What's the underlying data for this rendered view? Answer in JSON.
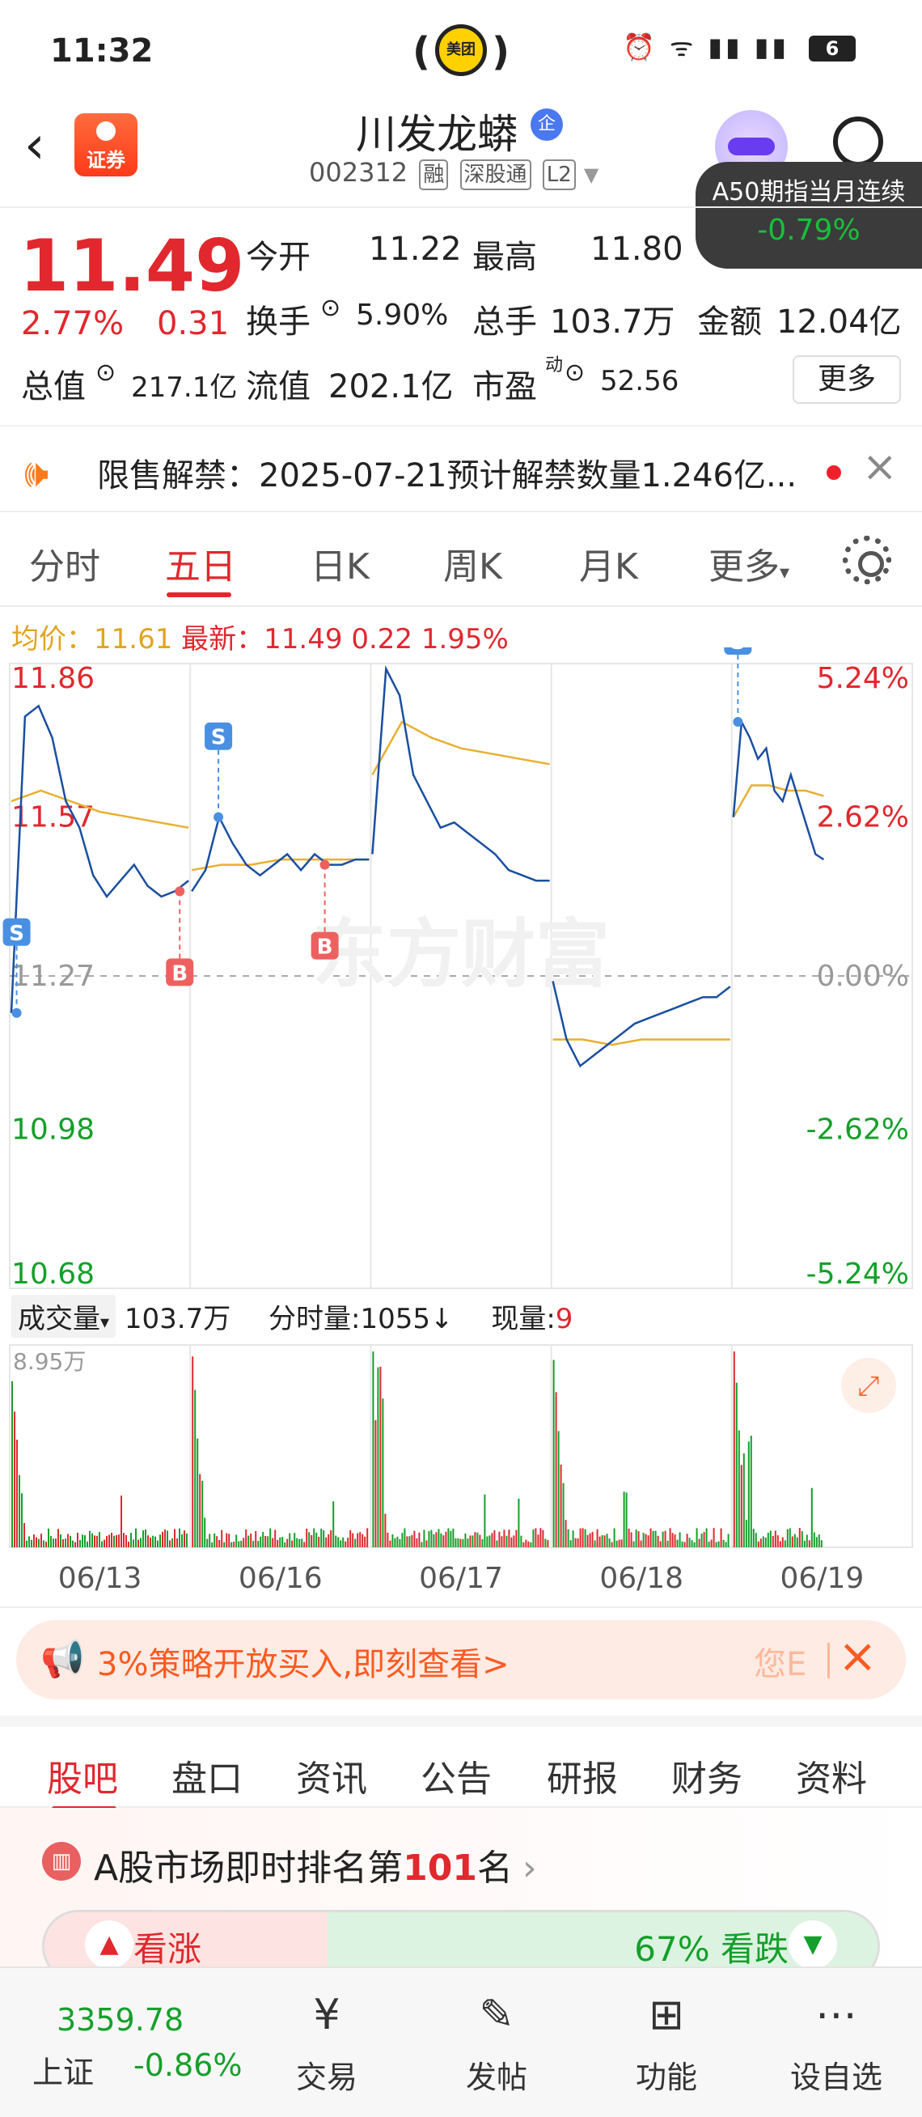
{
  "status_bar": {
    "time": "11:32",
    "center_app": "美团",
    "battery": "6"
  },
  "header": {
    "back_icon": "chevron-left-icon",
    "app_logo_text": "证券",
    "stock_name": "川发龙蟒",
    "qi_badge": "企",
    "stock_code": "002312",
    "tags": [
      "融",
      "深股通",
      "L2"
    ],
    "popup": {
      "title": "A50期指当月连续",
      "value": "-0.79%"
    }
  },
  "quote": {
    "price": "11.49",
    "change_pct": "2.77%",
    "change": "0.31",
    "open_label": "今开",
    "open": "11.22",
    "high_label": "最高",
    "high": "11.80",
    "turnover_label": "换手",
    "turnover": "5.90%",
    "volume_label": "总手",
    "volume": "103.7万",
    "amount_label": "金额",
    "amount": "12.04亿",
    "mktcap_label": "总值",
    "mktcap": "217.1亿",
    "float_label": "流值",
    "float": "202.1亿",
    "pe_label": "市盈",
    "pe_sup": "动",
    "pe": "52.56",
    "more_button": "更多"
  },
  "notice": {
    "text": "限售解禁：2025-07-21预计解禁数量1.246亿..."
  },
  "chart_tabs": [
    "分时",
    "五日",
    "日K",
    "周K",
    "月K",
    "更多"
  ],
  "chart_tab_active": 1,
  "avg_line": {
    "avg_label": "均价：",
    "avg": "11.61",
    "latest_label": "最新：",
    "latest": "11.49",
    "change": "0.22",
    "pct": "1.95%"
  },
  "chart_data": {
    "type": "line",
    "title": "",
    "y_left_ticks": [
      "11.86",
      "11.57",
      "11.27",
      "10.98",
      "10.68"
    ],
    "y_right_ticks": [
      "5.24%",
      "2.62%",
      "0.00%",
      "-2.62%",
      "-5.24%"
    ],
    "ylim": [
      10.68,
      11.86
    ],
    "x_labels": [
      "06/13",
      "06/16",
      "06/17",
      "06/18",
      "06/19"
    ],
    "watermark": "东方财富",
    "price_series": [
      {
        "day": "06/13",
        "values": [
          11.2,
          11.76,
          11.78,
          11.72,
          11.6,
          11.55,
          11.46,
          11.42,
          11.45,
          11.48,
          11.44,
          11.42,
          11.43,
          11.45
        ]
      },
      {
        "day": "06/16",
        "values": [
          11.43,
          11.47,
          11.57,
          11.52,
          11.48,
          11.46,
          11.48,
          11.5,
          11.47,
          11.5,
          11.48,
          11.48,
          11.49,
          11.49
        ]
      },
      {
        "day": "06/17",
        "values": [
          11.5,
          11.85,
          11.8,
          11.65,
          11.6,
          11.55,
          11.56,
          11.54,
          11.52,
          11.5,
          11.47,
          11.46,
          11.45,
          11.45
        ]
      },
      {
        "day": "06/18",
        "values": [
          11.26,
          11.15,
          11.1,
          11.12,
          11.14,
          11.16,
          11.18,
          11.19,
          11.2,
          11.21,
          11.22,
          11.23,
          11.23,
          11.25
        ]
      },
      {
        "day": "06/19",
        "values": [
          11.57,
          11.75,
          11.72,
          11.68,
          11.7,
          11.62,
          11.6,
          11.65,
          11.6,
          11.55,
          11.5,
          11.49
        ]
      }
    ],
    "avg_series": [
      {
        "day": "06/13",
        "values": [
          11.6,
          11.62,
          11.6,
          11.58,
          11.57,
          11.56,
          11.55
        ]
      },
      {
        "day": "06/16",
        "values": [
          11.47,
          11.48,
          11.48,
          11.49,
          11.49,
          11.49,
          11.49
        ]
      },
      {
        "day": "06/17",
        "values": [
          11.65,
          11.75,
          11.72,
          11.7,
          11.69,
          11.68,
          11.67
        ]
      },
      {
        "day": "06/18",
        "values": [
          11.15,
          11.15,
          11.14,
          11.15,
          11.15,
          11.15,
          11.15
        ]
      },
      {
        "day": "06/19",
        "values": [
          11.57,
          11.63,
          11.63,
          11.62,
          11.62,
          11.61
        ]
      }
    ],
    "markers": [
      {
        "label": "S",
        "day": "06/13"
      },
      {
        "label": "B",
        "day": "06/13"
      },
      {
        "label": "S",
        "day": "06/16"
      },
      {
        "label": "B",
        "day": "06/16"
      },
      {
        "label": "S",
        "day": "06/19"
      }
    ],
    "colors": {
      "price": "#1a4fa0",
      "avg": "#e8b030",
      "up": "#e0282e",
      "down": "#14a02a",
      "buy": "#ee6060",
      "sell": "#4a90e2"
    }
  },
  "volume": {
    "label": "成交量",
    "total": "103.7万",
    "minute_label": "分时量:",
    "minute_value": "1055",
    "minute_arrow": "↓",
    "current_label": "现量:",
    "current_value": "9",
    "max_label": "8.95万",
    "expand_icon": "expand-icon"
  },
  "promo": {
    "text": "3%策略开放买入,即刻查看>",
    "side_text": "您E"
  },
  "bottom_tabs": [
    "股吧",
    "盘口",
    "资讯",
    "公告",
    "研报",
    "财务",
    "资料"
  ],
  "rank": {
    "prefix": "A股市场即时排名第",
    "rank": "101",
    "suffix": "名",
    "up_label": "看涨",
    "down_label": "67% 看跌"
  },
  "bottom_nav": {
    "index_value": "3359.78",
    "index_name": "上证",
    "index_pct": "-0.86%",
    "items": [
      {
        "label": "交易",
        "icon": "yen-icon"
      },
      {
        "label": "发帖",
        "icon": "edit-icon"
      },
      {
        "label": "功能",
        "icon": "grid-icon"
      },
      {
        "label": "设自选",
        "icon": "more-dots-icon"
      }
    ]
  }
}
